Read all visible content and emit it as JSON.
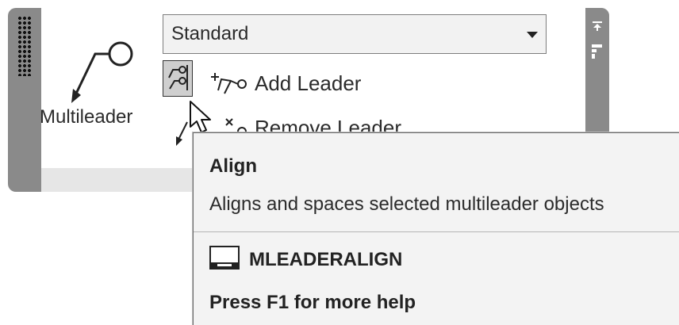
{
  "panel": {
    "multileader_label": "Multileader",
    "style_select": {
      "value": "Standard"
    },
    "add_leader_label": "Add Leader",
    "remove_leader_label": "Remove Leader",
    "icons": [
      "grip-icon",
      "multileader-icon",
      "align-leaders-icon",
      "add-leader-icon",
      "remove-leader-icon",
      "collect-leaders-icon",
      "pin-panel-icon",
      "panel-options-icon",
      "mouse-cursor-icon"
    ]
  },
  "tooltip": {
    "title": "Align",
    "description": "Aligns and spaces selected multileader objects",
    "command": "MLEADERALIGN",
    "help": "Press F1 for more help",
    "command_icon": "command-window-icon"
  }
}
